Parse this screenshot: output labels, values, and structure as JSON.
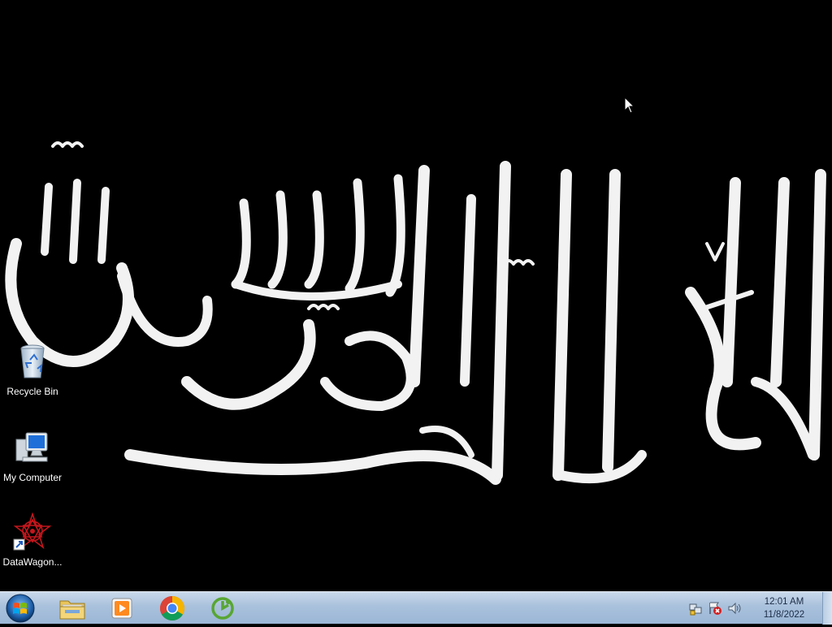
{
  "desktop": {
    "wallpaper": "black-flag-calligraphy",
    "icons": [
      {
        "label": "Recycle Bin",
        "icon": "recycle-bin-icon"
      },
      {
        "label": "My Computer",
        "icon": "computer-icon"
      },
      {
        "label": "DataWagon...",
        "icon": "datawagon-shortcut-icon"
      }
    ]
  },
  "taskbar": {
    "start": "windows-start-orb",
    "pinned": [
      {
        "name": "file-explorer-icon"
      },
      {
        "name": "media-player-icon"
      },
      {
        "name": "chrome-icon"
      },
      {
        "name": "green-app-icon"
      }
    ],
    "tray": [
      "network-icon",
      "action-center-icon",
      "volume-icon"
    ],
    "clock": {
      "time": "12:01 AM",
      "date": "11/8/2022"
    }
  },
  "colors": {
    "desktop": "#000000",
    "taskbar": "#a9c1dc",
    "clock_text": "#1b2b45"
  }
}
